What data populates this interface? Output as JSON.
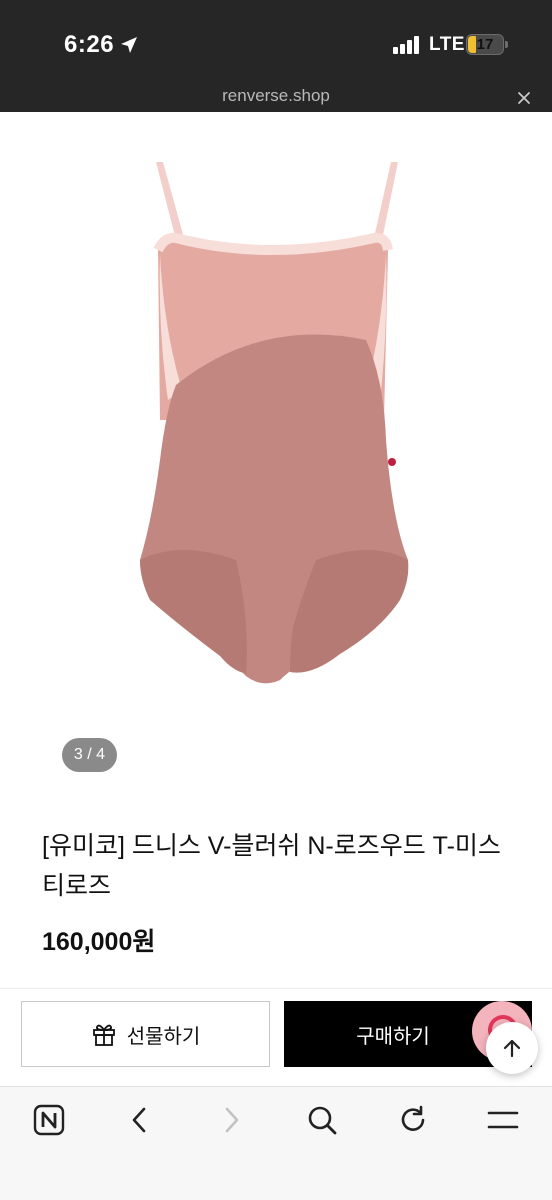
{
  "status_bar": {
    "time": "6:26",
    "network": "LTE",
    "battery": "17"
  },
  "browser": {
    "url": "renverse.shop"
  },
  "product": {
    "image_alt": "leotard",
    "page_indicator": "3 / 4",
    "title": "[유미코] 드니스 V-블러쉬 N-로즈우드 T-미스티로즈",
    "price": "160,000원"
  },
  "actions": {
    "gift_label": "선물하기",
    "buy_label": "구매하기"
  },
  "colors": {
    "strap": "#f2cfca",
    "top_panel": "#e3a79f",
    "body": "#c28781",
    "trim": "#f6dcd6",
    "accent_dot": "#c02040",
    "chat_bg": "#f3b4bd",
    "chat_ring": "#e2375a"
  },
  "toolbar": {
    "items": [
      "naver-home-icon",
      "back-icon",
      "forward-icon",
      "search-icon",
      "refresh-icon",
      "menu-icon"
    ]
  }
}
